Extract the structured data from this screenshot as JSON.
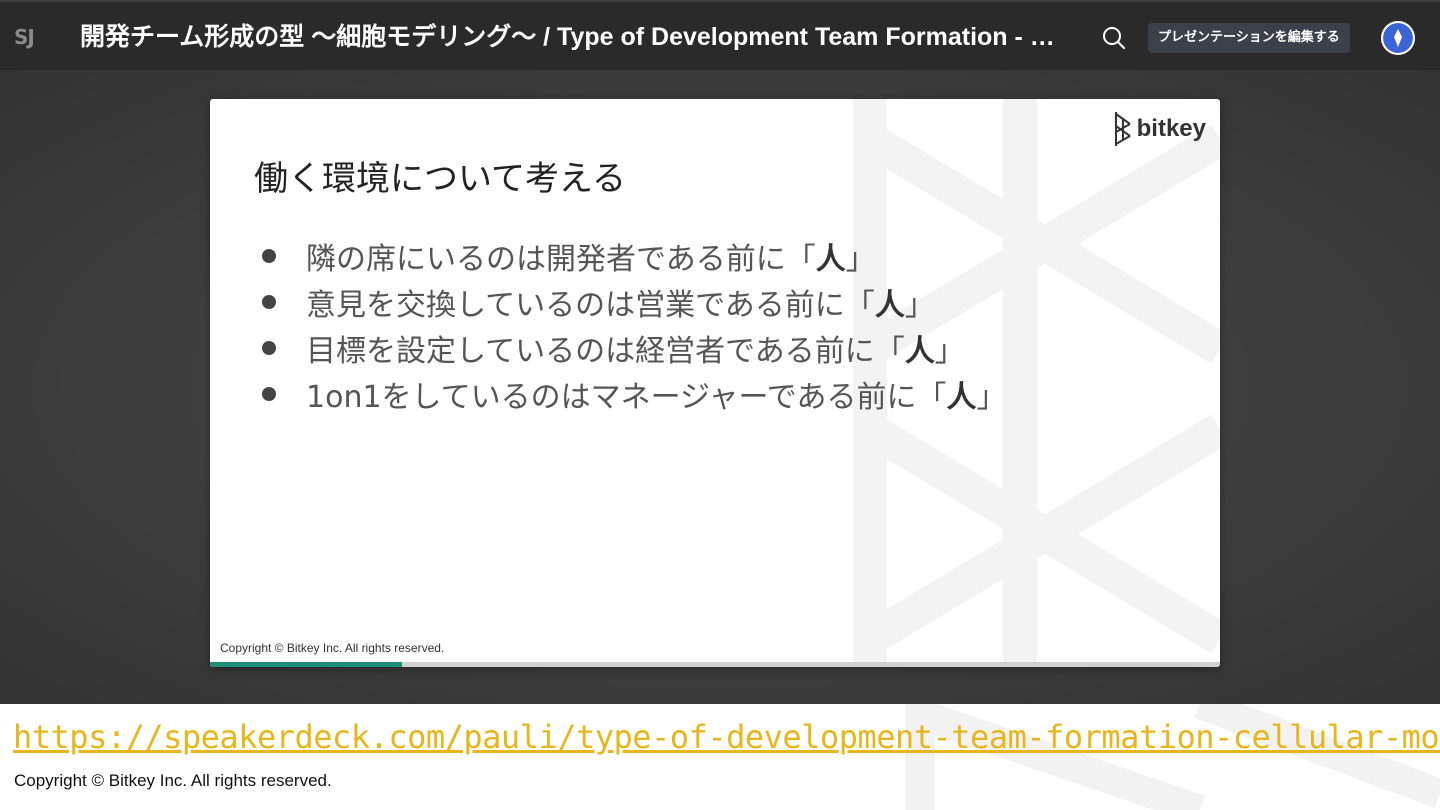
{
  "header": {
    "logo_text": "SJ",
    "title": "開発チーム形成の型 〜細胞モデリング〜 / Type of Development Team Formation - …",
    "edit_button_label": "プレゼンテーションを編集する",
    "search_icon": "search-icon",
    "avatar_icon": "user-avatar"
  },
  "slide": {
    "brand": "bitkey",
    "heading": "働く環境について考える",
    "bullets": [
      {
        "text": "隣の席にいるのは開発者である前に「",
        "bold": "人",
        "end": "」"
      },
      {
        "text": "意見を交換しているのは営業である前に「",
        "bold": "人",
        "end": "」"
      },
      {
        "text": "目標を設定しているのは経営者である前に「",
        "bold": "人",
        "end": "」"
      },
      {
        "text": "1on1をしているのはマネージャーである前に「",
        "bold": "人",
        "end": "」"
      }
    ],
    "copyright": "Copyright © Bitkey Inc. All rights reserved.",
    "progress": 0.19,
    "progress_color": "#1f8f7a"
  },
  "footer": {
    "link": "https://speakerdeck.com/pauli/type-of-development-team-formation-cellular-modeling",
    "copyright": "Copyright © Bitkey Inc. All rights reserved.",
    "link_color": "#e8b51a"
  }
}
